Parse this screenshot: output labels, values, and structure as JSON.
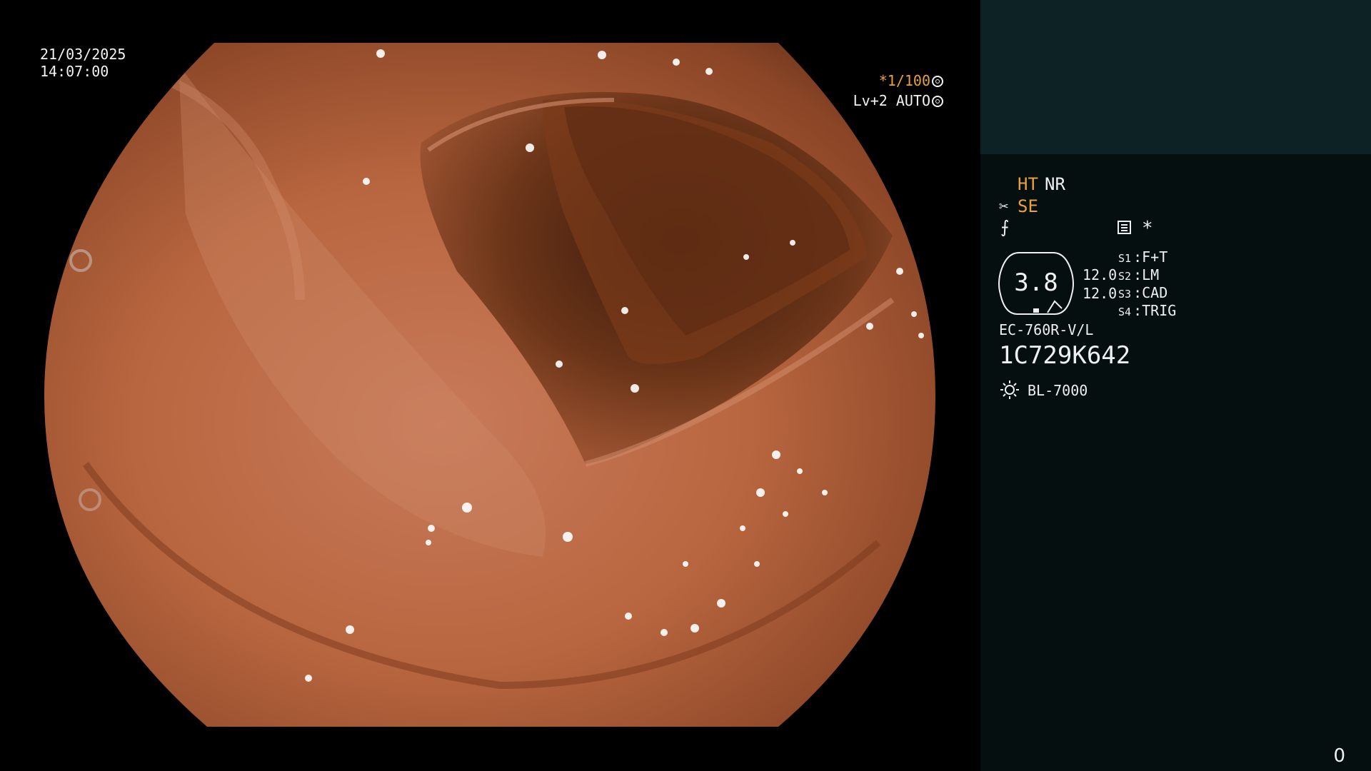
{
  "timestamp": {
    "date": "21/03/2025",
    "time": "14:07:00"
  },
  "exposure": {
    "shutter_prefix": "*",
    "shutter": "1/100",
    "level": "Lv+2",
    "mode": "AUTO"
  },
  "side": {
    "ht": "HT",
    "nr": "NR",
    "se": "SE",
    "star": "*",
    "gauge_value": "3.8",
    "values": [
      "12.0",
      "12.0"
    ],
    "switches": [
      {
        "key": "S1",
        "value": "F+T"
      },
      {
        "key": "S2",
        "value": "LM"
      },
      {
        "key": "S3",
        "value": "CAD"
      },
      {
        "key": "S4",
        "value": "TRIG"
      }
    ],
    "scope_model": "EC-760R-V/L",
    "serial": "1C729K642",
    "light_source": "BL-7000",
    "counter": "0"
  },
  "icons": [
    "shutter-wheel-icon",
    "aperture-icon",
    "scissors-icon",
    "flash-icon",
    "menu-icon",
    "sun-icon"
  ],
  "colors": {
    "accent": "#e8a23a",
    "panel_top": "#0c2224",
    "panel": "#060f10"
  }
}
